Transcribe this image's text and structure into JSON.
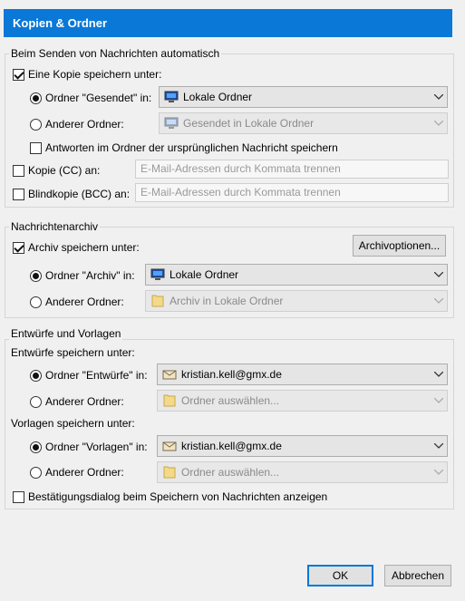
{
  "dialog": {
    "title": "Kopien & Ordner"
  },
  "sending": {
    "legend": "Beim Senden von Nachrichten automatisch",
    "save_copy_label": "Eine Kopie speichern unter:",
    "sent_folder_label": "Ordner \"Gesendet\" in:",
    "sent_folder_value": "Lokale Ordner",
    "other_folder_label": "Anderer Ordner:",
    "other_folder_value": "Gesendet in Lokale Ordner",
    "replies_label": "Antworten im Ordner der ursprünglichen Nachricht speichern",
    "cc_label": "Kopie (CC) an:",
    "cc_placeholder": "E-Mail-Adressen durch Kommata trennen",
    "bcc_label": "Blindkopie (BCC) an:",
    "bcc_placeholder": "E-Mail-Adressen durch Kommata trennen"
  },
  "archive": {
    "legend": "Nachrichtenarchiv",
    "save_label": "Archiv speichern unter:",
    "options_button": "Archivoptionen...",
    "archive_folder_label": "Ordner \"Archiv\" in:",
    "archive_folder_value": "Lokale Ordner",
    "other_folder_label": "Anderer Ordner:",
    "other_folder_value": "Archiv in Lokale Ordner"
  },
  "drafts": {
    "legend": "Entwürfe und Vorlagen",
    "drafts_heading": "Entwürfe speichern unter:",
    "drafts_folder_label": "Ordner \"Entwürfe\" in:",
    "drafts_folder_value": "kristian.kell@gmx.de",
    "drafts_other_label": "Anderer Ordner:",
    "drafts_other_value": "Ordner auswählen...",
    "templates_heading": "Vorlagen speichern unter:",
    "templates_folder_label": "Ordner \"Vorlagen\" in:",
    "templates_folder_value": "kristian.kell@gmx.de",
    "templates_other_label": "Anderer Ordner:",
    "templates_other_value": "Ordner auswählen...",
    "confirm_label": "Bestätigungsdialog beim Speichern von Nachrichten anzeigen"
  },
  "footer": {
    "ok": "OK",
    "cancel": "Abbrechen"
  },
  "colors": {
    "accent": "#0a78d7",
    "group_border": "#d5d5d5",
    "dialog_bg": "#f0f0f0"
  }
}
